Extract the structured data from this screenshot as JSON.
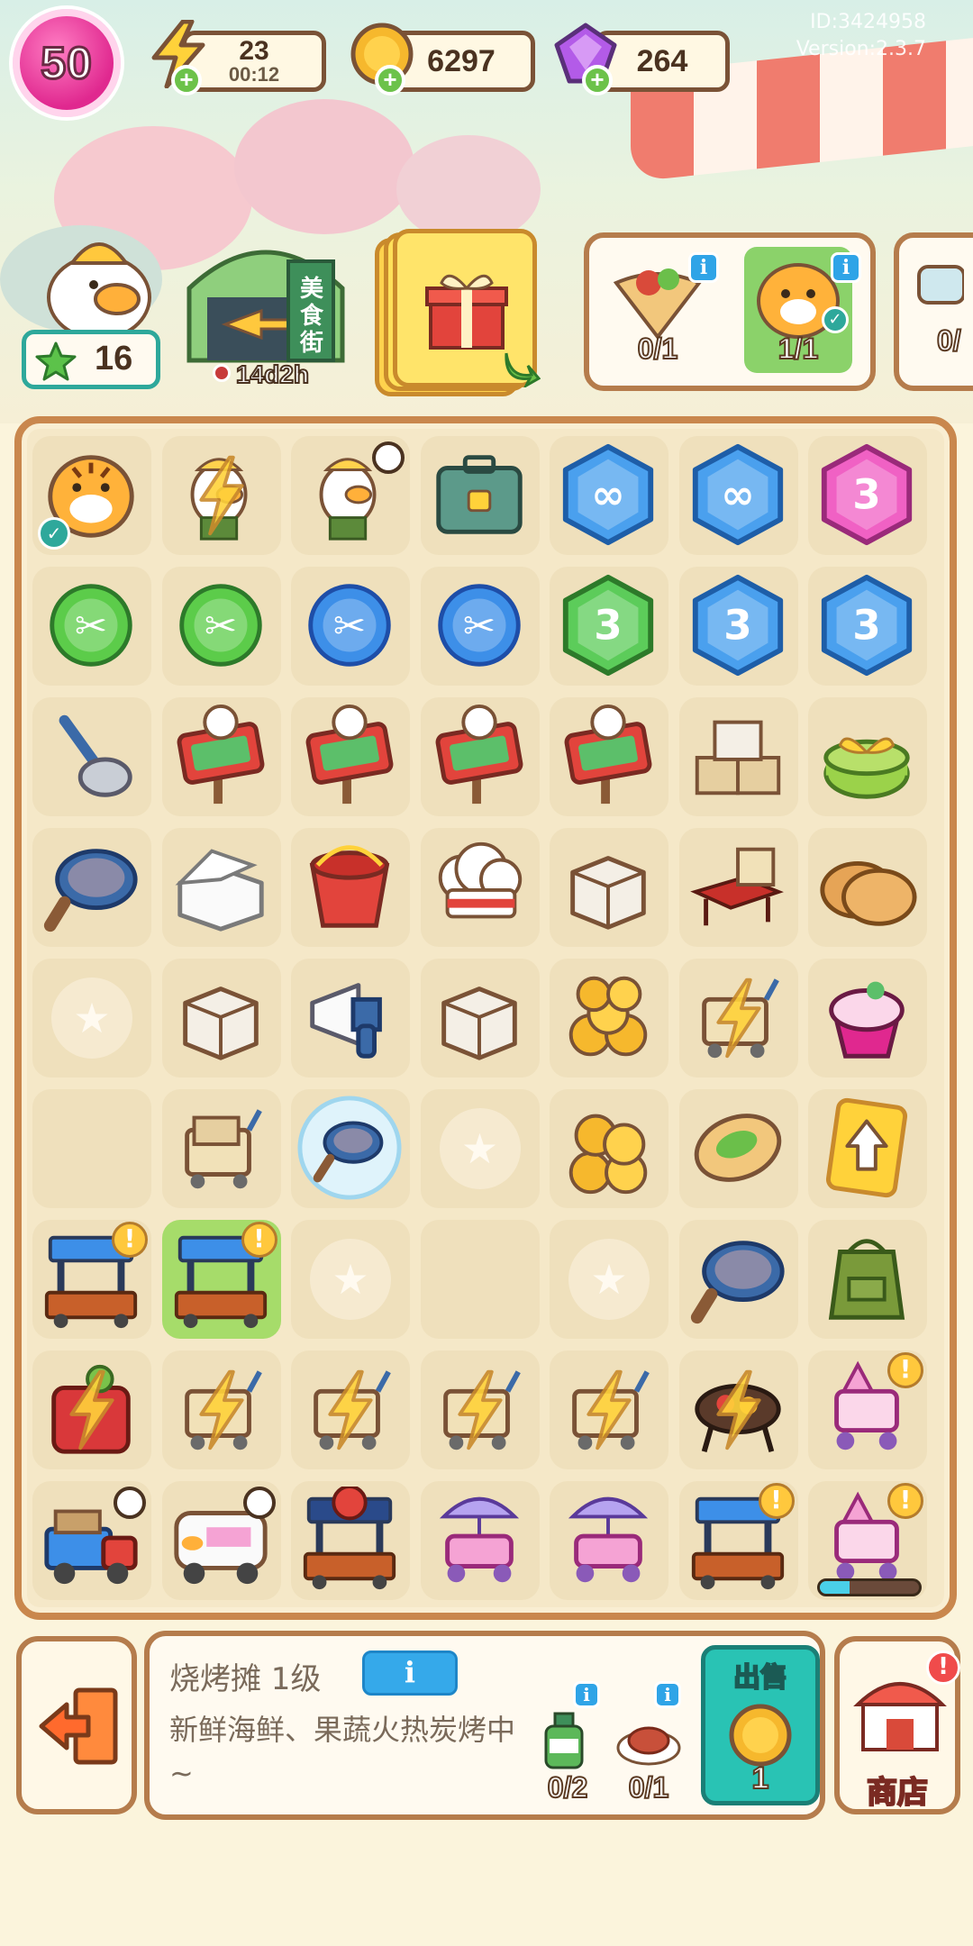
{
  "debug": {
    "id": "ID:3424958",
    "version": "Version:2.3.7"
  },
  "top_bar": {
    "level": "50",
    "energy": {
      "value": "23",
      "timer": "00:12"
    },
    "coins": "6297",
    "gems": "264"
  },
  "row2": {
    "stars": "16",
    "event_timer": "14d2h",
    "event_sign": "美食街",
    "orders": [
      {
        "count": "0/1",
        "done": false
      },
      {
        "count": "1/1",
        "done": true
      },
      {
        "count": "0/",
        "done": false
      }
    ]
  },
  "board": {
    "cols": 7,
    "rows": 9,
    "cells": [
      "tiger-chest",
      "duck-builder",
      "duck-builder-timer",
      "toolbox",
      "blue-hex-infinity",
      "blue-hex-infinity",
      "pink-hex-3",
      "green-scissors",
      "green-scissors",
      "blue-scissors",
      "blue-scissors",
      "green-hex-3",
      "blue-hex-3",
      "blue-hex-3",
      "ladle",
      "open-sign",
      "open-sign",
      "open-sign",
      "open-sign",
      "stack-boxes",
      "green-gift",
      "frying-pan",
      "takeout-box",
      "red-bucket",
      "chef-hat",
      "cardboard-box",
      "picnic-table",
      "pancakes",
      "empty",
      "cardboard-box",
      "megaphone",
      "cardboard-box",
      "coin-pile",
      "cart-energy",
      "ice-cream",
      "blank",
      "box-cart",
      "bubble-pan",
      "empty",
      "coin-stack",
      "burrito",
      "yellow-arrow-card",
      "bbq-stall",
      "bbq-stall-selected",
      "empty",
      "blank",
      "empty",
      "frying-pan",
      "green-apron",
      "red-energy-bag",
      "cart-energy",
      "cart-energy",
      "cart-energy",
      "cart-energy",
      "grill-energy",
      "pink-cart-alert",
      "delivery-truck",
      "food-van",
      "lobster-stall",
      "pink-parasol-cart",
      "pink-parasol-cart",
      "bbq-stall-alert",
      "pink-cart-alert-progress"
    ]
  },
  "info": {
    "title": "烧烤摊 1级",
    "description": "新鲜海鲜、果蔬火热炭烤中~",
    "requirements": [
      {
        "count": "0/2",
        "icon": "bottle-icon"
      },
      {
        "count": "0/1",
        "icon": "meat-dish-icon"
      }
    ],
    "sell_label": "出售",
    "sell_price": "1",
    "shop_label": "商店"
  },
  "colors": {
    "brown_border": "#b57c4c",
    "board_bg": "#f5e8c8",
    "level_pink": "#e0288f",
    "sell_teal": "#29c3b4",
    "info_blue": "#35a9ea"
  }
}
